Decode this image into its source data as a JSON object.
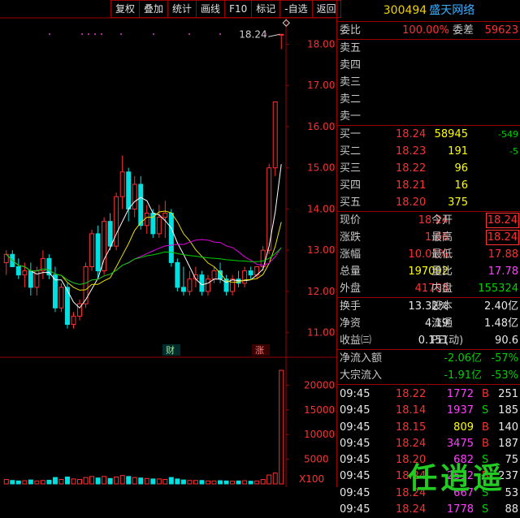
{
  "toolbar": [
    "复权",
    "叠加",
    "统计",
    "画线",
    "F10",
    "标记",
    "-自选",
    "返回"
  ],
  "stock": {
    "code": "300494",
    "name": "盛天网络"
  },
  "orderbook": {
    "weibi_label": "委比",
    "weibi_value": "100.00%",
    "weicha_label": "委差",
    "weicha_value": "59623",
    "asks": [
      {
        "label": "卖五",
        "price": "",
        "vol": "",
        "chg": ""
      },
      {
        "label": "卖四",
        "price": "",
        "vol": "",
        "chg": ""
      },
      {
        "label": "卖三",
        "price": "",
        "vol": "",
        "chg": ""
      },
      {
        "label": "卖二",
        "price": "",
        "vol": "",
        "chg": ""
      },
      {
        "label": "卖一",
        "price": "",
        "vol": "",
        "chg": ""
      }
    ],
    "bids": [
      {
        "label": "买一",
        "price": "18.24",
        "vol": "58945",
        "chg": "-549"
      },
      {
        "label": "买二",
        "price": "18.23",
        "vol": "191",
        "chg": "-5"
      },
      {
        "label": "买三",
        "price": "18.22",
        "vol": "96",
        "chg": ""
      },
      {
        "label": "买四",
        "price": "18.21",
        "vol": "16",
        "chg": ""
      },
      {
        "label": "买五",
        "price": "18.20",
        "vol": "375",
        "chg": ""
      }
    ]
  },
  "quote": {
    "r1": {
      "l1": "现价",
      "v1": "18.24",
      "l2": "今开",
      "v2": "18.24"
    },
    "r2": {
      "l1": "涨跌",
      "v1": "1.66",
      "l2": "最高",
      "v2": "18.24"
    },
    "r3": {
      "l1": "涨幅",
      "v1": "10.01%",
      "l2": "最低",
      "v2": "17.88"
    },
    "r4": {
      "l1": "总量",
      "v1": "197092",
      "l2": "量比",
      "v2": "17.78"
    },
    "r5": {
      "l1": "外盘",
      "v1": "41768",
      "l2": "内盘",
      "v2": "155324"
    },
    "r6": {
      "l1": "换手",
      "v1": "13.32%",
      "l2": "股本",
      "v2": "2.40亿"
    },
    "r7": {
      "l1": "净资",
      "v1": "4.19",
      "l2": "流通",
      "v2": "1.48亿"
    },
    "r8": {
      "l1": "收益㈢",
      "v1": "0.151",
      "l2": "PE(动)",
      "v2": "90.6"
    }
  },
  "flows": [
    {
      "label": "净流入额",
      "amount": "-2.06亿",
      "pct": "-57%"
    },
    {
      "label": "大宗流入",
      "amount": "-1.91亿",
      "pct": "-53%"
    }
  ],
  "trades": [
    {
      "time": "09:45",
      "price": "18.22",
      "vol": "1772",
      "side": "B",
      "n": "251"
    },
    {
      "time": "09:45",
      "price": "18.14",
      "vol": "1937",
      "side": "S",
      "n": "185"
    },
    {
      "time": "09:45",
      "price": "18.15",
      "vol": "809",
      "side": "B",
      "n": "140"
    },
    {
      "time": "09:45",
      "price": "18.24",
      "vol": "3475",
      "side": "B",
      "n": "187"
    },
    {
      "time": "09:45",
      "price": "18.20",
      "vol": "682",
      "side": "S",
      "n": "75"
    },
    {
      "time": "09:45",
      "price": "18.24",
      "vol": "2512",
      "side": "B",
      "n": "237"
    },
    {
      "time": "09:45",
      "price": "18.24",
      "vol": "667",
      "side": "S",
      "n": "53"
    },
    {
      "time": "09:45",
      "price": "18.24",
      "vol": "1778",
      "side": "S",
      "n": "88"
    }
  ],
  "chart": {
    "price_ticks": [
      "18.00",
      "17.00",
      "16.00",
      "15.00",
      "14.00",
      "13.00",
      "12.00",
      "11.00"
    ],
    "volume_ticks": [
      "20000",
      "15000",
      "10000",
      "5000"
    ],
    "volume_unit": "X100",
    "last_price_label": "18.24",
    "badges": [
      "财",
      "涨"
    ],
    "colors": {
      "up": "#ff3030",
      "down": "#00e0e0",
      "ma5": "#ffffff",
      "ma10": "#e8e000",
      "ma20": "#e000e0",
      "ma60": "#00d000",
      "frame": "#9a0000"
    }
  },
  "chart_data": {
    "type": "candlestick",
    "ylim": [
      10.6,
      18.6
    ],
    "candles": [
      {
        "o": 12.7,
        "h": 13.0,
        "l": 12.4,
        "c": 12.9
      },
      {
        "o": 12.9,
        "h": 13.0,
        "l": 12.6,
        "c": 12.6
      },
      {
        "o": 12.6,
        "h": 12.8,
        "l": 12.3,
        "c": 12.4
      },
      {
        "o": 12.4,
        "h": 12.7,
        "l": 12.1,
        "c": 12.5
      },
      {
        "o": 12.5,
        "h": 12.7,
        "l": 11.9,
        "c": 12.1
      },
      {
        "o": 12.1,
        "h": 12.6,
        "l": 11.9,
        "c": 12.5
      },
      {
        "o": 12.5,
        "h": 13.0,
        "l": 12.3,
        "c": 12.8
      },
      {
        "o": 12.8,
        "h": 12.9,
        "l": 12.3,
        "c": 12.4
      },
      {
        "o": 12.4,
        "h": 12.6,
        "l": 11.5,
        "c": 11.6
      },
      {
        "o": 11.6,
        "h": 12.2,
        "l": 11.5,
        "c": 12.1
      },
      {
        "o": 12.1,
        "h": 12.2,
        "l": 11.1,
        "c": 11.2
      },
      {
        "o": 11.2,
        "h": 11.5,
        "l": 11.1,
        "c": 11.4
      },
      {
        "o": 11.4,
        "h": 11.8,
        "l": 11.3,
        "c": 11.7
      },
      {
        "o": 11.7,
        "h": 12.7,
        "l": 11.6,
        "c": 12.6
      },
      {
        "o": 12.6,
        "h": 13.5,
        "l": 12.5,
        "c": 13.4
      },
      {
        "o": 13.4,
        "h": 13.6,
        "l": 12.3,
        "c": 12.5
      },
      {
        "o": 12.5,
        "h": 13.8,
        "l": 12.4,
        "c": 13.7
      },
      {
        "o": 13.7,
        "h": 13.9,
        "l": 13.0,
        "c": 13.1
      },
      {
        "o": 13.1,
        "h": 14.4,
        "l": 13.0,
        "c": 14.3
      },
      {
        "o": 14.3,
        "h": 15.3,
        "l": 14.0,
        "c": 14.9
      },
      {
        "o": 14.9,
        "h": 15.0,
        "l": 13.7,
        "c": 14.0
      },
      {
        "o": 14.0,
        "h": 14.8,
        "l": 13.8,
        "c": 14.6
      },
      {
        "o": 14.6,
        "h": 14.8,
        "l": 13.5,
        "c": 13.6
      },
      {
        "o": 13.6,
        "h": 14.1,
        "l": 13.4,
        "c": 13.9
      },
      {
        "o": 13.9,
        "h": 14.0,
        "l": 13.3,
        "c": 13.4
      },
      {
        "o": 13.4,
        "h": 14.1,
        "l": 13.3,
        "c": 13.8
      },
      {
        "o": 13.8,
        "h": 14.2,
        "l": 13.3,
        "c": 13.9
      },
      {
        "o": 13.9,
        "h": 14.0,
        "l": 12.6,
        "c": 12.7
      },
      {
        "o": 12.7,
        "h": 12.8,
        "l": 12.0,
        "c": 12.1
      },
      {
        "o": 12.1,
        "h": 12.6,
        "l": 11.9,
        "c": 12.0
      },
      {
        "o": 12.0,
        "h": 12.5,
        "l": 11.9,
        "c": 12.3
      },
      {
        "o": 12.3,
        "h": 12.6,
        "l": 12.1,
        "c": 12.4
      },
      {
        "o": 12.4,
        "h": 12.5,
        "l": 11.9,
        "c": 12.0
      },
      {
        "o": 12.0,
        "h": 12.4,
        "l": 11.9,
        "c": 12.3
      },
      {
        "o": 12.3,
        "h": 12.6,
        "l": 12.2,
        "c": 12.5
      },
      {
        "o": 12.5,
        "h": 12.7,
        "l": 12.2,
        "c": 12.3
      },
      {
        "o": 12.3,
        "h": 12.4,
        "l": 11.9,
        "c": 12.0
      },
      {
        "o": 12.0,
        "h": 12.4,
        "l": 11.9,
        "c": 12.3
      },
      {
        "o": 12.3,
        "h": 12.5,
        "l": 12.1,
        "c": 12.2
      },
      {
        "o": 12.2,
        "h": 12.6,
        "l": 12.1,
        "c": 12.5
      },
      {
        "o": 12.5,
        "h": 12.6,
        "l": 12.3,
        "c": 12.4
      },
      {
        "o": 12.4,
        "h": 12.6,
        "l": 12.3,
        "c": 12.6
      },
      {
        "o": 12.6,
        "h": 13.1,
        "l": 12.5,
        "c": 13.0
      },
      {
        "o": 13.0,
        "h": 15.1,
        "l": 12.9,
        "c": 15.0
      },
      {
        "o": 15.0,
        "h": 16.6,
        "l": 14.8,
        "c": 16.6
      },
      {
        "o": 18.24,
        "h": 18.24,
        "l": 17.88,
        "c": 18.24
      }
    ],
    "volumes": [
      900,
      700,
      600,
      650,
      800,
      600,
      700,
      750,
      1300,
      900,
      1400,
      1000,
      900,
      1300,
      1500,
      1200,
      1500,
      1100,
      1400,
      1700,
      1500,
      1300,
      1200,
      1100,
      1000,
      1000,
      900,
      1300,
      1000,
      800,
      700,
      700,
      700,
      600,
      600,
      650,
      600,
      550,
      600,
      650,
      550,
      600,
      900,
      1800,
      2200,
      23000
    ],
    "volume_ylim": [
      0,
      24000
    ]
  }
}
